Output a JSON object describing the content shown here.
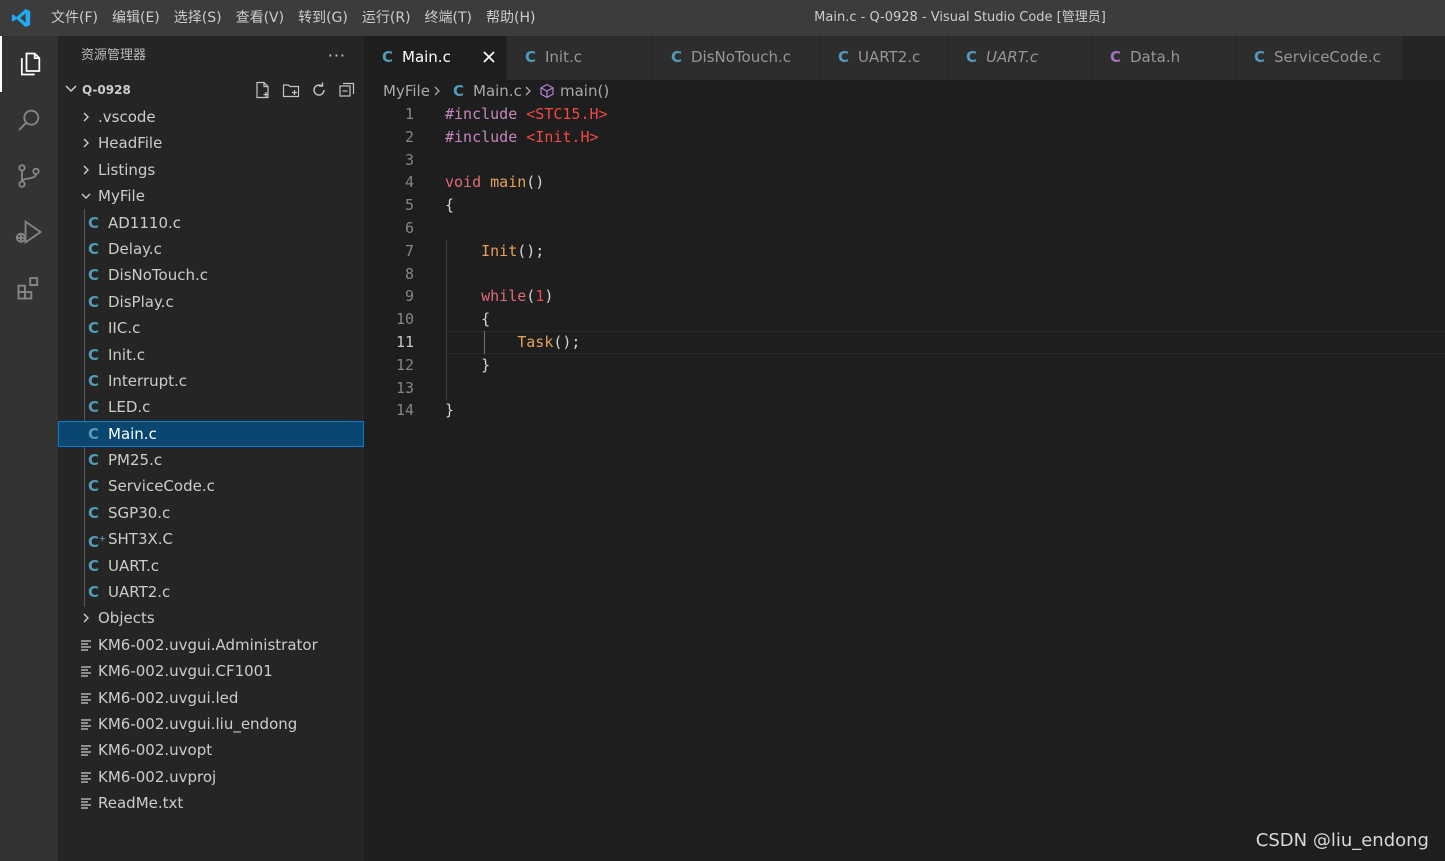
{
  "menu": [
    "文件(F)",
    "编辑(E)",
    "选择(S)",
    "查看(V)",
    "转到(G)",
    "运行(R)",
    "终端(T)",
    "帮助(H)"
  ],
  "window_title": "Main.c - Q-0928 - Visual Studio Code [管理员]",
  "activity_icons": [
    "explorer-icon",
    "search-icon",
    "source-control-icon",
    "run-debug-icon",
    "extensions-icon"
  ],
  "sidebar": {
    "title": "资源管理器",
    "more": "···",
    "root": "Q-0928",
    "tree": [
      {
        "type": "folder",
        "label": ".vscode",
        "open": false,
        "depth": 0
      },
      {
        "type": "folder",
        "label": "HeadFile",
        "open": false,
        "depth": 0
      },
      {
        "type": "folder",
        "label": "Listings",
        "open": false,
        "depth": 0
      },
      {
        "type": "folder",
        "label": "MyFile",
        "open": true,
        "depth": 0
      },
      {
        "type": "c",
        "label": "AD1110.c",
        "depth": 1
      },
      {
        "type": "c",
        "label": "Delay.c",
        "depth": 1
      },
      {
        "type": "c",
        "label": "DisNoTouch.c",
        "depth": 1
      },
      {
        "type": "c",
        "label": "DisPlay.c",
        "depth": 1
      },
      {
        "type": "c",
        "label": "IIC.c",
        "depth": 1
      },
      {
        "type": "c",
        "label": "Init.c",
        "depth": 1
      },
      {
        "type": "c",
        "label": "Interrupt.c",
        "depth": 1
      },
      {
        "type": "c",
        "label": "LED.c",
        "depth": 1
      },
      {
        "type": "c",
        "label": "Main.c",
        "depth": 1,
        "selected": true
      },
      {
        "type": "c",
        "label": "PM25.c",
        "depth": 1
      },
      {
        "type": "c",
        "label": "ServiceCode.c",
        "depth": 1
      },
      {
        "type": "c",
        "label": "SGP30.c",
        "depth": 1
      },
      {
        "type": "cpp",
        "label": "SHT3X.C",
        "depth": 1
      },
      {
        "type": "c",
        "label": "UART.c",
        "depth": 1
      },
      {
        "type": "c",
        "label": "UART2.c",
        "depth": 1
      },
      {
        "type": "folder",
        "label": "Objects",
        "open": false,
        "depth": 0
      },
      {
        "type": "file",
        "label": "KM6-002.uvgui.Administrator",
        "depth": 0
      },
      {
        "type": "file",
        "label": "KM6-002.uvgui.CF1001",
        "depth": 0
      },
      {
        "type": "file",
        "label": "KM6-002.uvgui.led",
        "depth": 0
      },
      {
        "type": "file",
        "label": "KM6-002.uvgui.liu_endong",
        "depth": 0
      },
      {
        "type": "file",
        "label": "KM6-002.uvopt",
        "depth": 0
      },
      {
        "type": "file",
        "label": "KM6-002.uvproj",
        "depth": 0
      },
      {
        "type": "file",
        "label": "ReadMe.txt",
        "depth": 0
      }
    ]
  },
  "tabs": [
    {
      "label": "Main.c",
      "icon": "C",
      "active": true,
      "italic": false,
      "color": "#519aba"
    },
    {
      "label": "Init.c",
      "icon": "C",
      "active": false,
      "italic": false,
      "color": "#519aba"
    },
    {
      "label": "DisNoTouch.c",
      "icon": "C",
      "active": false,
      "italic": false,
      "color": "#519aba"
    },
    {
      "label": "UART2.c",
      "icon": "C",
      "active": false,
      "italic": false,
      "color": "#519aba"
    },
    {
      "label": "UART.c",
      "icon": "C",
      "active": false,
      "italic": true,
      "color": "#519aba"
    },
    {
      "label": "Data.h",
      "icon": "C",
      "active": false,
      "italic": false,
      "color": "#a074c4"
    },
    {
      "label": "ServiceCode.c",
      "icon": "C",
      "active": false,
      "italic": false,
      "color": "#519aba"
    }
  ],
  "breadcrumb": {
    "folder": "MyFile",
    "file": "Main.c",
    "symbol": "main()"
  },
  "editor": {
    "current_line": 11,
    "lines": [
      [
        {
          "t": "#include ",
          "c": "kw-dir"
        },
        {
          "t": "<STC15.H>",
          "c": "kw-str"
        }
      ],
      [
        {
          "t": "#include ",
          "c": "kw-dir"
        },
        {
          "t": "<Init.H>",
          "c": "kw-str"
        }
      ],
      [],
      [
        {
          "t": "void ",
          "c": "kw-ty"
        },
        {
          "t": "main",
          "c": "kw-fn"
        },
        {
          "t": "()",
          "c": "br"
        }
      ],
      [
        {
          "t": "{",
          "c": "br"
        }
      ],
      [],
      [
        {
          "t": "    "
        },
        {
          "t": "Init",
          "c": "kw-fn"
        },
        {
          "t": "();",
          "c": "br"
        }
      ],
      [],
      [
        {
          "t": "    "
        },
        {
          "t": "while",
          "c": "kw-ty"
        },
        {
          "t": "(",
          "c": "br"
        },
        {
          "t": "1",
          "c": "kw-num"
        },
        {
          "t": ")",
          "c": "br"
        }
      ],
      [
        {
          "t": "    "
        },
        {
          "t": "{",
          "c": "br"
        }
      ],
      [
        {
          "t": "        "
        },
        {
          "t": "Task",
          "c": "kw-fn"
        },
        {
          "t": "();",
          "c": "br"
        }
      ],
      [
        {
          "t": "    "
        },
        {
          "t": "}",
          "c": "br"
        }
      ],
      [],
      [
        {
          "t": "}",
          "c": "br"
        }
      ]
    ]
  },
  "watermark": "CSDN @liu_endong"
}
